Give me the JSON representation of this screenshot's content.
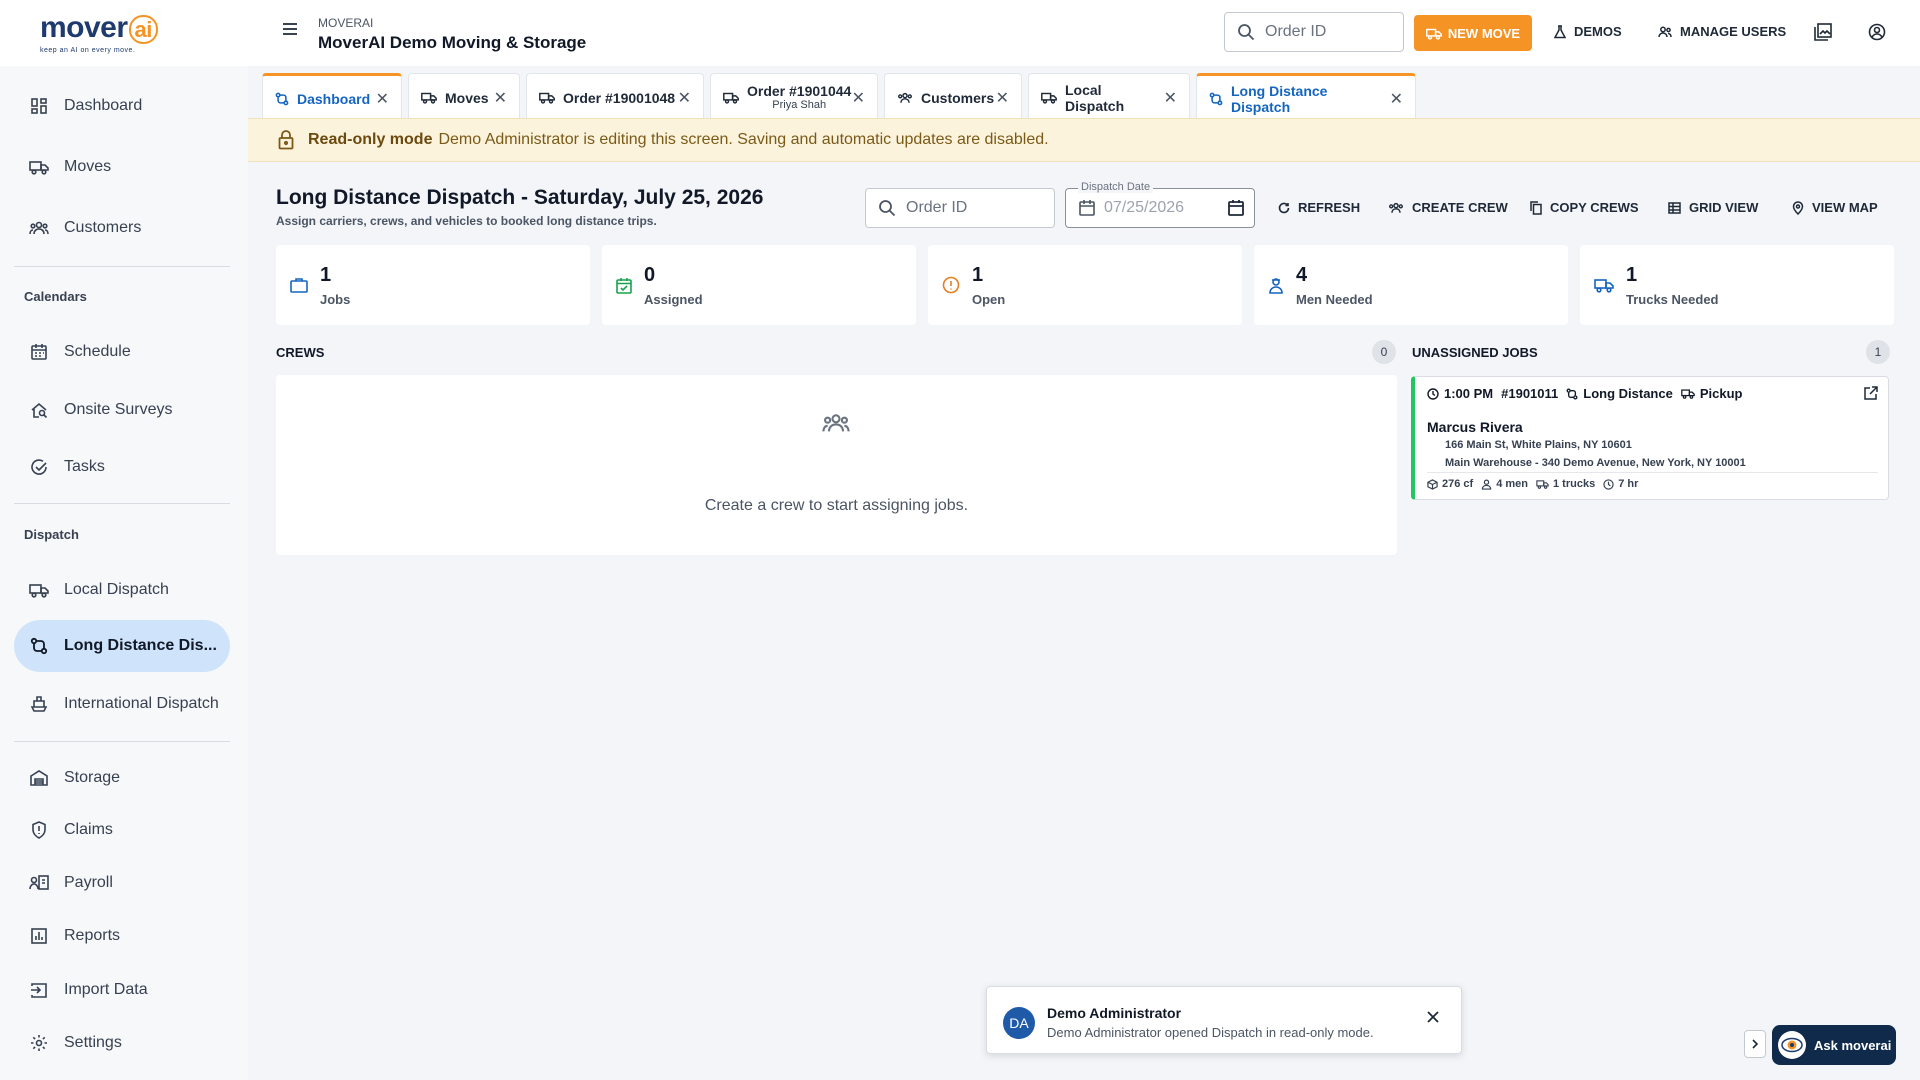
{
  "logo": {
    "brand": "mover",
    "ai": "ai",
    "tagline": "keep an AI on every move."
  },
  "header": {
    "company_small": "MOVERAI",
    "company_name": "MoverAI Demo Moving & Storage",
    "search_placeholder": "Order ID",
    "new_move": "NEW MOVE",
    "demos": "DEMOS",
    "manage_users": "MANAGE USERS"
  },
  "sidebar": {
    "items": [
      {
        "label": "Dashboard",
        "icon": "dashboard-icon"
      },
      {
        "label": "Moves",
        "icon": "truck-icon"
      },
      {
        "label": "Customers",
        "icon": "people-icon"
      },
      {
        "label": "Schedule",
        "icon": "calendar-icon"
      },
      {
        "label": "Onsite Surveys",
        "icon": "house-search-icon"
      },
      {
        "label": "Tasks",
        "icon": "check-circle-icon"
      },
      {
        "label": "Local Dispatch",
        "icon": "truck-icon"
      },
      {
        "label": "Long Distance Dis...",
        "icon": "route-icon"
      },
      {
        "label": "International Dispatch",
        "icon": "ship-icon"
      },
      {
        "label": "Storage",
        "icon": "warehouse-icon"
      },
      {
        "label": "Claims",
        "icon": "shield-icon"
      },
      {
        "label": "Payroll",
        "icon": "payroll-icon"
      },
      {
        "label": "Reports",
        "icon": "reports-icon"
      },
      {
        "label": "Import Data",
        "icon": "import-icon"
      },
      {
        "label": "Settings",
        "icon": "gear-icon"
      }
    ],
    "sections": {
      "calendars": "Calendars",
      "dispatch": "Dispatch"
    }
  },
  "tabs": [
    {
      "label": "Dashboard"
    },
    {
      "label": "Moves"
    },
    {
      "label": "Order #19001048"
    },
    {
      "label": "Order #1901044",
      "sub": "Priya Shah"
    },
    {
      "label": "Customers"
    },
    {
      "label": "Local Dispatch"
    },
    {
      "label": "Long Distance Dispatch"
    }
  ],
  "banner": {
    "title": "Read-only mode",
    "message": "Demo Administrator is editing this screen. Saving and automatic updates are disabled."
  },
  "page": {
    "title": "Long Distance Dispatch - Saturday, July 25, 2026",
    "subtitle": "Assign carriers, crews, and vehicles to booked long distance trips.",
    "order_placeholder": "Order ID",
    "date_label": "Dispatch Date",
    "date_value": "07/25/2026",
    "actions": {
      "refresh": "REFRESH",
      "create_crew": "CREATE CREW",
      "copy_crews": "COPY CREWS",
      "grid_view": "GRID VIEW",
      "view_map": "VIEW MAP"
    }
  },
  "stats": [
    {
      "value": "1",
      "label": "Jobs"
    },
    {
      "value": "0",
      "label": "Assigned"
    },
    {
      "value": "1",
      "label": "Open"
    },
    {
      "value": "4",
      "label": "Men Needed"
    },
    {
      "value": "1",
      "label": "Trucks Needed"
    }
  ],
  "crews": {
    "title": "CREWS",
    "count": "0",
    "empty_text": "Create a crew to start assigning jobs."
  },
  "unassigned": {
    "title": "UNASSIGNED JOBS",
    "count": "1",
    "job": {
      "time": "1:00 PM",
      "order": "#1901011",
      "type": "Long Distance",
      "service": "Pickup",
      "customer": "Marcus Rivera",
      "origin": "166 Main St, White Plains, NY 10601",
      "destination": "Main Warehouse - 340 Demo Avenue, New York, NY 10001",
      "cf": "276 cf",
      "men": "4 men",
      "trucks": "1 trucks",
      "hours": "7 hr"
    }
  },
  "toast": {
    "initials": "DA",
    "title": "Demo Administrator",
    "message": "Demo Administrator opened Dispatch in read-only mode."
  },
  "assistant": {
    "label": "Ask moverai"
  },
  "colors": {
    "accent": "#f59324",
    "brand": "#1e3a6e",
    "active_nav": "#cfe4fb",
    "active_tab": "#1565c0",
    "job_border": "#22c55e"
  }
}
